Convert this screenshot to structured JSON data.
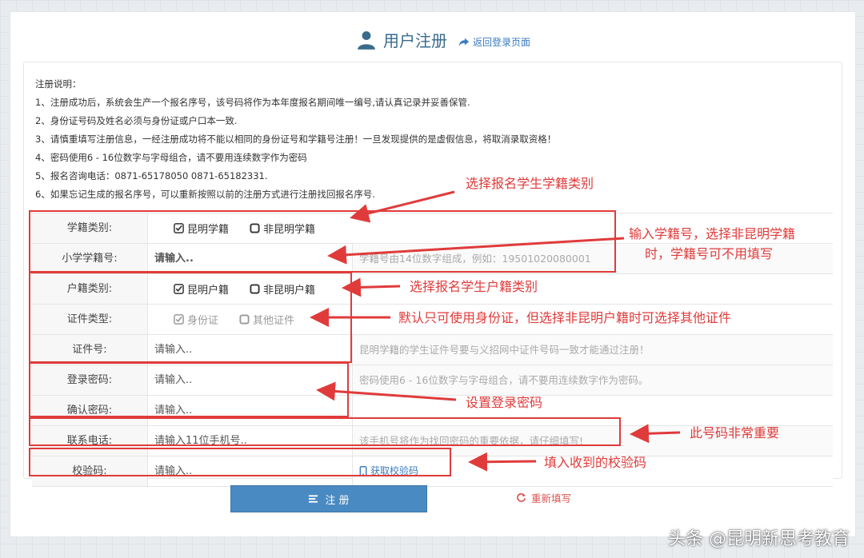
{
  "header": {
    "title": "用户注册",
    "back_link": "返回登录页面"
  },
  "notes": {
    "title": "注册说明：",
    "items": [
      "1、注册成功后，系统会生产一个报名序号，该号码将作为本年度报名期间唯一编号,请认真记录并妥善保管.",
      "2、身份证号码及姓名必须与身份证或户口本一致.",
      "3、请慎重填写注册信息，一经注册成功将不能以相同的身份证号和学籍号注册！一旦发现提供的是虚假信息，将取消录取资格！",
      "4、密码使用6 - 16位数字与字母组合，请不要用连续数字作为密码",
      "5、报名咨询电话：0871-65178050 0871-65182331.",
      "6、如果忘记生成的报名序号，可以重新按照以前的注册方式进行注册找回报名序号."
    ]
  },
  "form": {
    "xueji_type": {
      "label": "学籍类别:",
      "opt1": "昆明学籍",
      "opt2": "非昆明学籍"
    },
    "xueji_no": {
      "label": "小学学籍号:",
      "placeholder": "请输入..",
      "hint": "学籍号由14位数字组成，例如：19501020080001"
    },
    "huji_type": {
      "label": "户籍类别:",
      "opt1": "昆明户籍",
      "opt2": "非昆明户籍"
    },
    "cert_type": {
      "label": "证件类型:",
      "opt1": "身份证",
      "opt2": "其他证件"
    },
    "cert_no": {
      "label": "证件号:",
      "placeholder": "请输入..",
      "hint": "昆明学籍的学生证件号要与义招网中证件号码一致才能通过注册！"
    },
    "password": {
      "label": "登录密码:",
      "placeholder": "请输入..",
      "hint": "密码使用6 - 16位数字与字母组合，请不要用连续数字作为密码。"
    },
    "confirm": {
      "label": "确认密码:",
      "placeholder": "请输入.."
    },
    "phone": {
      "label": "联系电话:",
      "placeholder": "请输入11位手机号..",
      "hint": "该手机号将作为找回密码的重要依据，请仔细填写!"
    },
    "code": {
      "label": "校验码:",
      "placeholder": "请输入..",
      "link": "获取校验码"
    }
  },
  "buttons": {
    "register": "注 册",
    "reset": "重新填写"
  },
  "annotations": {
    "a1": "选择报名学生学籍类别",
    "a2_line1": "输入学籍号，选择非昆明学籍",
    "a2_line2": "时，学籍号可不用填写",
    "a3": "选择报名学生户籍类别",
    "a4": "默认只可使用身份证，但选择非昆明户籍时可选择其他证件",
    "a5": "设置登录密码",
    "a6": "此号码非常重要",
    "a7": "填入收到的校验码"
  },
  "watermark": "头条 @昆明新思考教育",
  "colors": {
    "accent": "#4a8ac2",
    "annotation": "#e03b3b",
    "reset": "#d9534f"
  }
}
